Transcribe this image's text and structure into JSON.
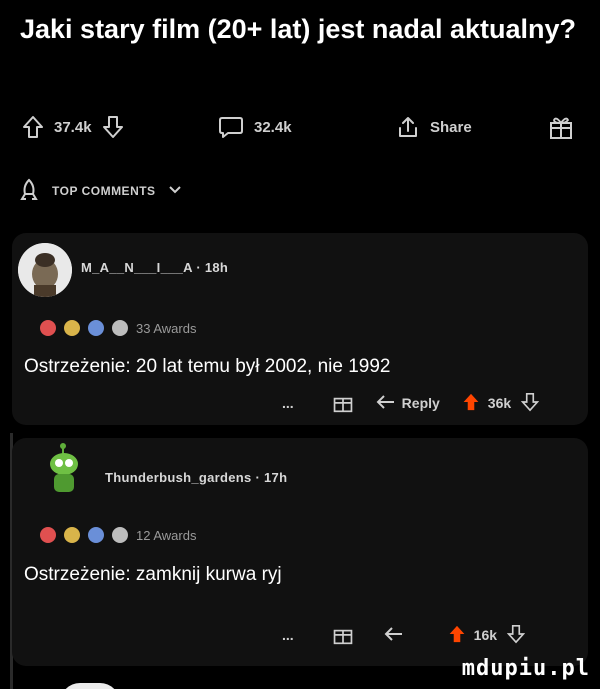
{
  "post": {
    "title": "Jaki stary film (20+ lat) jest nadal aktualny?",
    "upvotes": "37.4k",
    "comments": "32.4k",
    "share_label": "Share"
  },
  "sort": {
    "label": "TOP COMMENTS"
  },
  "comments": [
    {
      "username": "M_A__N___I___A",
      "age": "18h",
      "awards": "33 Awards",
      "body": "Ostrzeżenie: 20 lat temu był 2002, nie 1992",
      "more": "...",
      "reply_label": "Reply",
      "score": "36k"
    },
    {
      "username": "Thunderbush_gardens",
      "age": "17h",
      "awards": "12 Awards",
      "body": "Ostrzeżenie: zamknij kurwa ryj",
      "more": "...",
      "score": "16k"
    }
  ],
  "watermark": "mdupiu.pl",
  "colors": {
    "upvote_accent": "#ff4500",
    "background": "#000000",
    "card": "#111111"
  }
}
